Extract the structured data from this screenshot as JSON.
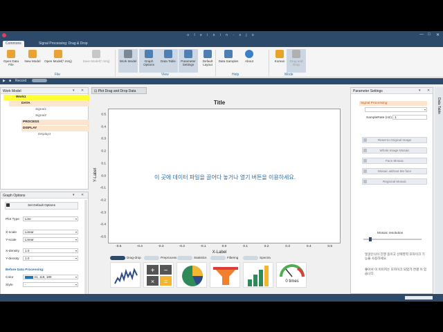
{
  "window": {
    "title": "o l e i n i n - s j o",
    "controls": [
      "—",
      "□",
      "✕"
    ]
  },
  "tabs": [
    {
      "label": "Commons",
      "active": true
    },
    {
      "label": "Signal Processing: Drag & Drop",
      "active": false
    }
  ],
  "ribbon": {
    "buttons": [
      {
        "label": "Open Data File",
        "icon": "folder-open-icon",
        "color": "#e7a434"
      },
      {
        "label": "New Model",
        "icon": "new-model-icon",
        "color": "#e7a434"
      },
      {
        "label": "Open Model(*.mmj)",
        "icon": "open-model-icon",
        "color": "#e7a434"
      },
      {
        "label": "Save Model(*.mmj)",
        "icon": "save-model-icon",
        "color": "#c7c7c7"
      },
      {
        "label": "Work Model",
        "icon": "work-model-icon",
        "color": "#7b8795"
      },
      {
        "label": "Graph Options",
        "icon": "graph-options-icon",
        "color": "#4d7fb3"
      },
      {
        "label": "Data Table",
        "icon": "data-table-icon",
        "color": "#4d7fb3"
      },
      {
        "label": "Parameter Settings",
        "icon": "parameter-settings-icon",
        "color": "#4d7fb3"
      },
      {
        "label": "Default Layout",
        "icon": "default-layout-icon",
        "color": "#4d7fb3"
      },
      {
        "label": "Data Samples",
        "icon": "data-samples-icon",
        "color": "#4d7fb3"
      },
      {
        "label": "About",
        "icon": "about-icon",
        "color": "#3d7fc7"
      },
      {
        "label": "Korean",
        "icon": "language-icon",
        "color": "#e8a427"
      },
      {
        "label": "Drag and Drop",
        "icon": "drag-drop-mode-icon",
        "color": "#b0b0b0"
      }
    ],
    "groups": [
      "File",
      "View",
      "Help",
      "Mode"
    ]
  },
  "toolbar": {
    "record_label": "Record"
  },
  "work_model": {
    "title": "Work Model",
    "items": [
      {
        "label": "Work1"
      },
      {
        "label": "DATA"
      },
      {
        "label": "Signal1"
      },
      {
        "label": "Signal2"
      },
      {
        "label": "PROCESS"
      },
      {
        "label": "DISPLAY"
      },
      {
        "label": "Display1"
      }
    ]
  },
  "graph_options": {
    "title": "Graph Options",
    "set_default_label": "Set Default Options",
    "fields": [
      {
        "label": "Plot Type",
        "value": "Line"
      },
      {
        "label": "X-scale",
        "value": "Linear"
      },
      {
        "label": "Y-scale",
        "value": "Linear"
      },
      {
        "label": "X-density",
        "value": "1.0"
      },
      {
        "label": "Y-density",
        "value": "1.0"
      }
    ],
    "before_label": "Before Data Processing:",
    "color_label": "Color",
    "color_value": "31, 119, 180",
    "color_swatch": "#1f77b4",
    "style_label": "Style",
    "style_value": "-"
  },
  "plot_tab": {
    "title": "Plot Drag and Drop Data"
  },
  "chart_data": {
    "type": "line",
    "title": "Title",
    "xlabel": "X-Label",
    "ylabel": "Y-Label",
    "xlim": [
      -0.55,
      0.55
    ],
    "ylim": [
      -0.55,
      0.55
    ],
    "xticks": [
      -0.5,
      -0.4,
      -0.3,
      -0.2,
      -0.1,
      0.0,
      0.1,
      0.2,
      0.3,
      0.4,
      0.5
    ],
    "yticks": [
      -0.5,
      -0.4,
      -0.3,
      -0.2,
      -0.1,
      0.0,
      0.1,
      0.2,
      0.3,
      0.4,
      0.5
    ],
    "xtick_labels": [
      "-0.5",
      "-0.4",
      "-0.3",
      "-0.2",
      "-0.1",
      "0.0",
      "0.1",
      "0.2",
      "0.3",
      "0.4",
      "0.5"
    ],
    "ytick_labels": [
      "-0.5",
      "-0.4",
      "-0.3",
      "-0.2",
      "-0.1",
      "0.0",
      "0.1",
      "0.2",
      "0.3",
      "0.4",
      "0.5"
    ],
    "series": [],
    "annotation": "이 곳에 데이터 파일을 끌어다 놓거나 열기 버튼을 이용하세요."
  },
  "bottom_toggles": [
    {
      "label": "Drag-drop",
      "on": true
    },
    {
      "label": "Preprocess",
      "on": false
    },
    {
      "label": "Statistics",
      "on": false
    },
    {
      "label": "Filtering",
      "on": false
    },
    {
      "label": "Spectra",
      "on": false
    }
  ],
  "bottom_cards": [
    {
      "name": "signal-card-icon"
    },
    {
      "name": "calculator-card-icon"
    },
    {
      "name": "pie-card-icon"
    },
    {
      "name": "filter-card-icon"
    },
    {
      "name": "bar-card-icon"
    },
    {
      "name": "gauge-card-icon",
      "text": "0 times"
    }
  ],
  "parameter_settings": {
    "title": "Parameter Settings",
    "section": "Signal Processing",
    "samplerate_label": "SampleRate (Hz)",
    "samplerate_value": "1",
    "buttons": [
      {
        "label": "Reset to Original Image"
      },
      {
        "label": "Whole Image Mosaic"
      },
      {
        "label": "Face Mosaic"
      },
      {
        "label": "Mosaic without Me face"
      },
      {
        "label": "Regional Mosaic"
      }
    ],
    "slider_label": "Mosaic resolution",
    "slider_value": 0.1,
    "note1": "얼굴인식이 진행 중이고 선택영역 모자이크 기능을 사용하세요.",
    "note2": "좋아서 이 이미지는 모자이크 되었가 연결 이 있습니다."
  },
  "data_table_tab": "Data Table"
}
